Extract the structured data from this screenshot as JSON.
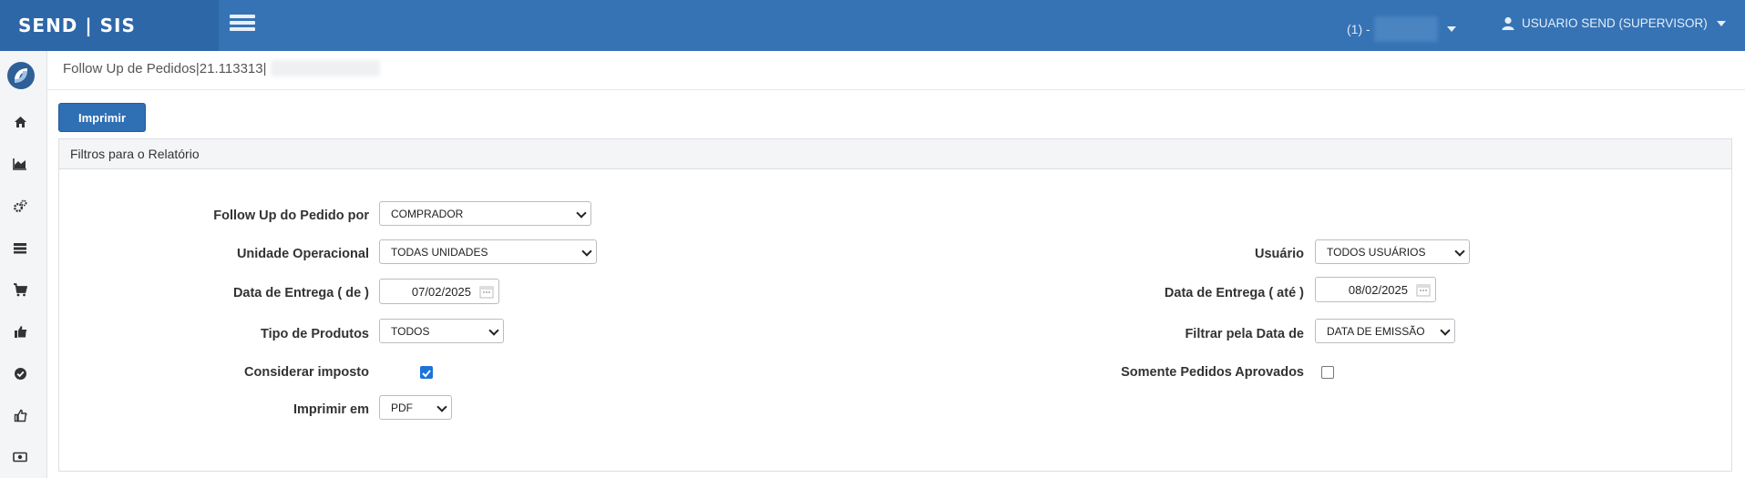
{
  "app": {
    "brand": "SEND | SIS"
  },
  "header": {
    "unit_prefix": "(1) -",
    "user": "USUARIO SEND (SUPERVISOR)"
  },
  "sidebar": {
    "icons": [
      "home-icon",
      "chart-icon",
      "cogs-icon",
      "list-icon",
      "cart-icon",
      "thumbs-up-icon",
      "check-circle-icon",
      "like-icon",
      "money-icon"
    ]
  },
  "page": {
    "breadcrumb": "Follow Up de Pedidos|21.113313|",
    "print_button": "Imprimir"
  },
  "panel": {
    "title": "Filtros para o Relatório",
    "follow_up_label": "Follow Up do Pedido por",
    "follow_up_value": "COMPRADOR",
    "unidade_label": "Unidade Operacional",
    "unidade_value": "TODAS UNIDADES",
    "usuario_label": "Usuário",
    "usuario_value": "TODOS USUÁRIOS",
    "entrega_de_label": "Data de Entrega ( de )",
    "entrega_de_value": "07/02/2025",
    "entrega_ate_label": "Data de Entrega ( até )",
    "entrega_ate_value": "08/02/2025",
    "tipo_label": "Tipo de Produtos",
    "tipo_value": "TODOS",
    "filtrar_label": "Filtrar pela Data de",
    "filtrar_value": "DATA DE EMISSÃO",
    "imposto_label": "Considerar imposto",
    "imposto_checked": true,
    "aprovados_label": "Somente Pedidos Aprovados",
    "aprovados_checked": false,
    "imprimir_em_label": "Imprimir em",
    "imprimir_em_value": "PDF"
  },
  "colors": {
    "header": "#3573b5",
    "brand": "#2d67a8",
    "button": "#2f6fb3",
    "checkbox": "#1d74d8"
  }
}
